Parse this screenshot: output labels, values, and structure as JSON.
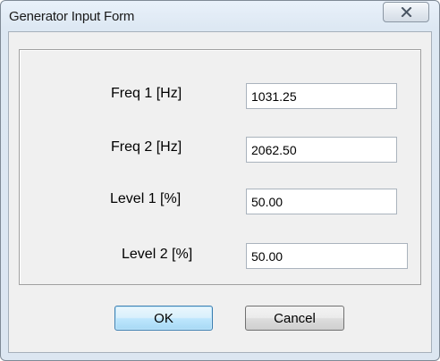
{
  "window": {
    "title": "Generator Input Form",
    "close_icon": "close-icon"
  },
  "form": {
    "fields": [
      {
        "label": "Freq 1 [Hz]",
        "value": "1031.25"
      },
      {
        "label": "Freq 2 [Hz]",
        "value": "2062.50"
      },
      {
        "label": "Level 1 [%]",
        "value": "50.00"
      },
      {
        "label": "Level 2 [%]",
        "value": "50.00"
      }
    ]
  },
  "buttons": {
    "ok_label": "OK",
    "cancel_label": "Cancel"
  },
  "colors": {
    "default_button_border": "#3c7fb1",
    "titlebar": "#dde8f3"
  }
}
